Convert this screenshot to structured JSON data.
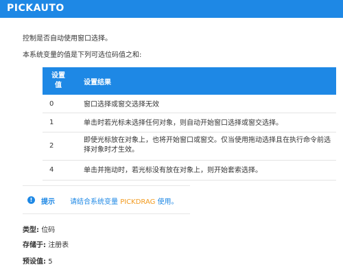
{
  "colors": {
    "accent": "#1e88e5",
    "highlight": "#f29b20",
    "row_border": "#e3e3e3"
  },
  "header": {
    "title": "PICKAUTO"
  },
  "intro": {
    "line1": "控制是否自动使用窗口选择。",
    "line2": "本系统变量的值是下列可选位码值之和:"
  },
  "table": {
    "col1_header_line1": "设置",
    "col1_header_line2": "值",
    "col2_header": "设置结果",
    "rows": [
      {
        "value": "0",
        "result": "窗口选择或窗交选择无效"
      },
      {
        "value": "1",
        "result": "单击时若光标未选择任何对象，则自动开始窗口选择或窗交选择。"
      },
      {
        "value": "2",
        "result": "即使光标放在对象上，也将开始窗口或窗交。仅当使用拖动选择且在执行命令前选择对象时才生效。"
      },
      {
        "value": "4",
        "result": "单击并拖动时，若光标没有放在对象上，则开始套索选择。"
      }
    ]
  },
  "tip": {
    "icon": "info-icon",
    "icon_glyph": "!",
    "label": "提示",
    "text_before": "请结合系统变量",
    "text_highlight": "PICKDRAG",
    "text_after": "使用。"
  },
  "properties": {
    "type_label": "类型:",
    "type_value": "位码",
    "stored_label": "存储于:",
    "stored_value": "注册表",
    "default_label": "预设值:",
    "default_value": "5"
  }
}
